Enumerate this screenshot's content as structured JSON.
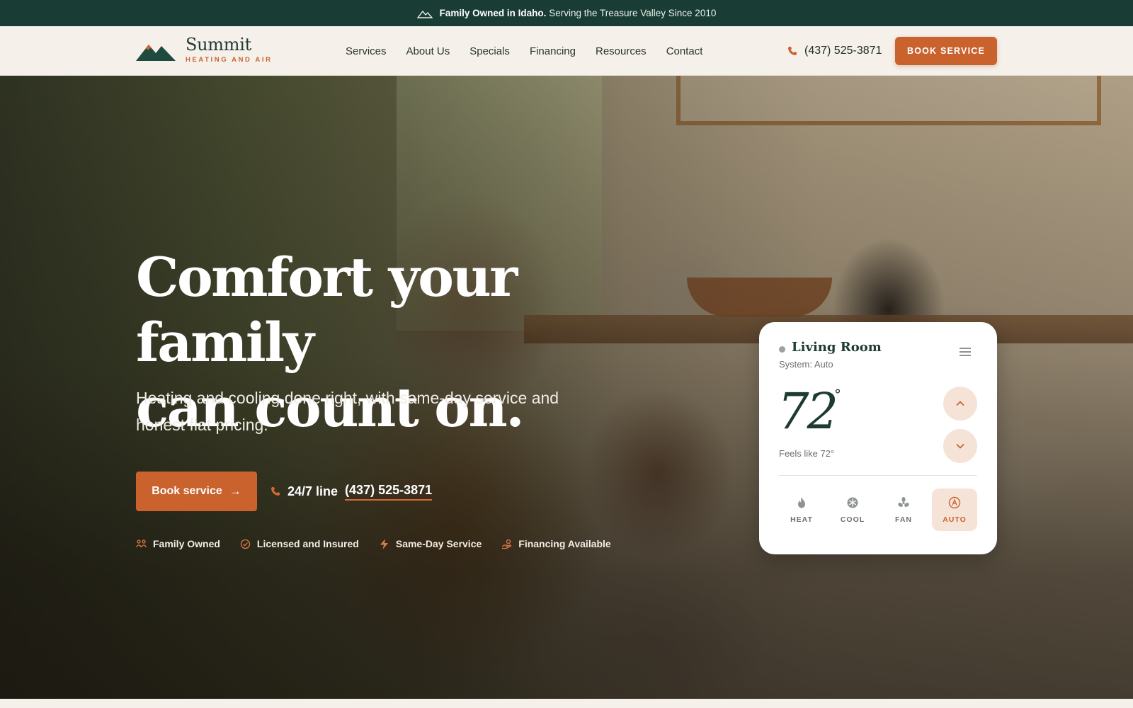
{
  "announcement": {
    "bold": "Family Owned in Idaho.",
    "text": "Serving the Treasure Valley Since 2010"
  },
  "brand": {
    "name": "Summit",
    "tagline": "HEATING AND AIR"
  },
  "nav": {
    "items": [
      "Services",
      "About Us",
      "Specials",
      "Financing",
      "Resources",
      "Contact"
    ]
  },
  "header": {
    "phone": "(437) 525-3871",
    "book_label": "BOOK SERVICE"
  },
  "hero": {
    "title_line1": "Comfort your family",
    "title_line2": "can count on.",
    "subtitle": "Heating and cooling done right, with same-day service and honest flat pricing.",
    "cta_label": "Book service",
    "line_label": "24/7 line",
    "line_phone": "(437) 525-3871",
    "badges": [
      "Family Owned",
      "Licensed and Insured",
      "Same-Day Service",
      "Financing Available"
    ]
  },
  "thermostat": {
    "room": "Living Room",
    "system": "System: Auto",
    "temperature": "72",
    "degree_symbol": "°",
    "feels_like": "Feels like 72°",
    "modes": [
      "HEAT",
      "COOL",
      "FAN",
      "AUTO"
    ],
    "active_mode": "AUTO"
  },
  "colors": {
    "brand_green": "#193d35",
    "accent_orange": "#c9622d",
    "cream": "#f5f0e9"
  }
}
